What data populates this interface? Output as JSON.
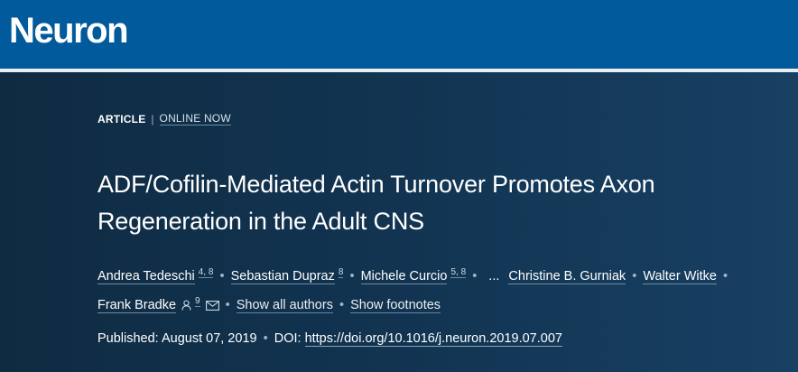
{
  "header": {
    "logo_text": "Neuron",
    "bg_color": "#005a9c"
  },
  "article": {
    "type_label": "ARTICLE",
    "separator": "|",
    "status_label": "ONLINE NOW",
    "title": "ADF/Cofilin-Mediated Actin Turnover Promotes Axon Regeneration in the Adult CNS",
    "authors": [
      {
        "name": "Andrea Tedeschi",
        "aff": "4, 8"
      },
      {
        "name": "Sebastian Dupraz",
        "aff": "8"
      },
      {
        "name": "Michele Curcio",
        "aff": "5, 8"
      },
      {
        "name": "Christine B. Gurniak",
        "aff": ""
      },
      {
        "name": "Walter Witke",
        "aff": ""
      },
      {
        "name": "Frank Bradke",
        "aff": "9"
      }
    ],
    "ellipsis": "...",
    "dot": "•",
    "show_all_authors": "Show all authors",
    "show_footnotes": "Show footnotes",
    "published_label": "Published:",
    "published_date": "August 07, 2019",
    "doi_label": "DOI:",
    "doi_url": "https://doi.org/10.1016/j.neuron.2019.07.007",
    "icons": {
      "corresponding": "person-icon",
      "email": "envelope-icon"
    }
  }
}
